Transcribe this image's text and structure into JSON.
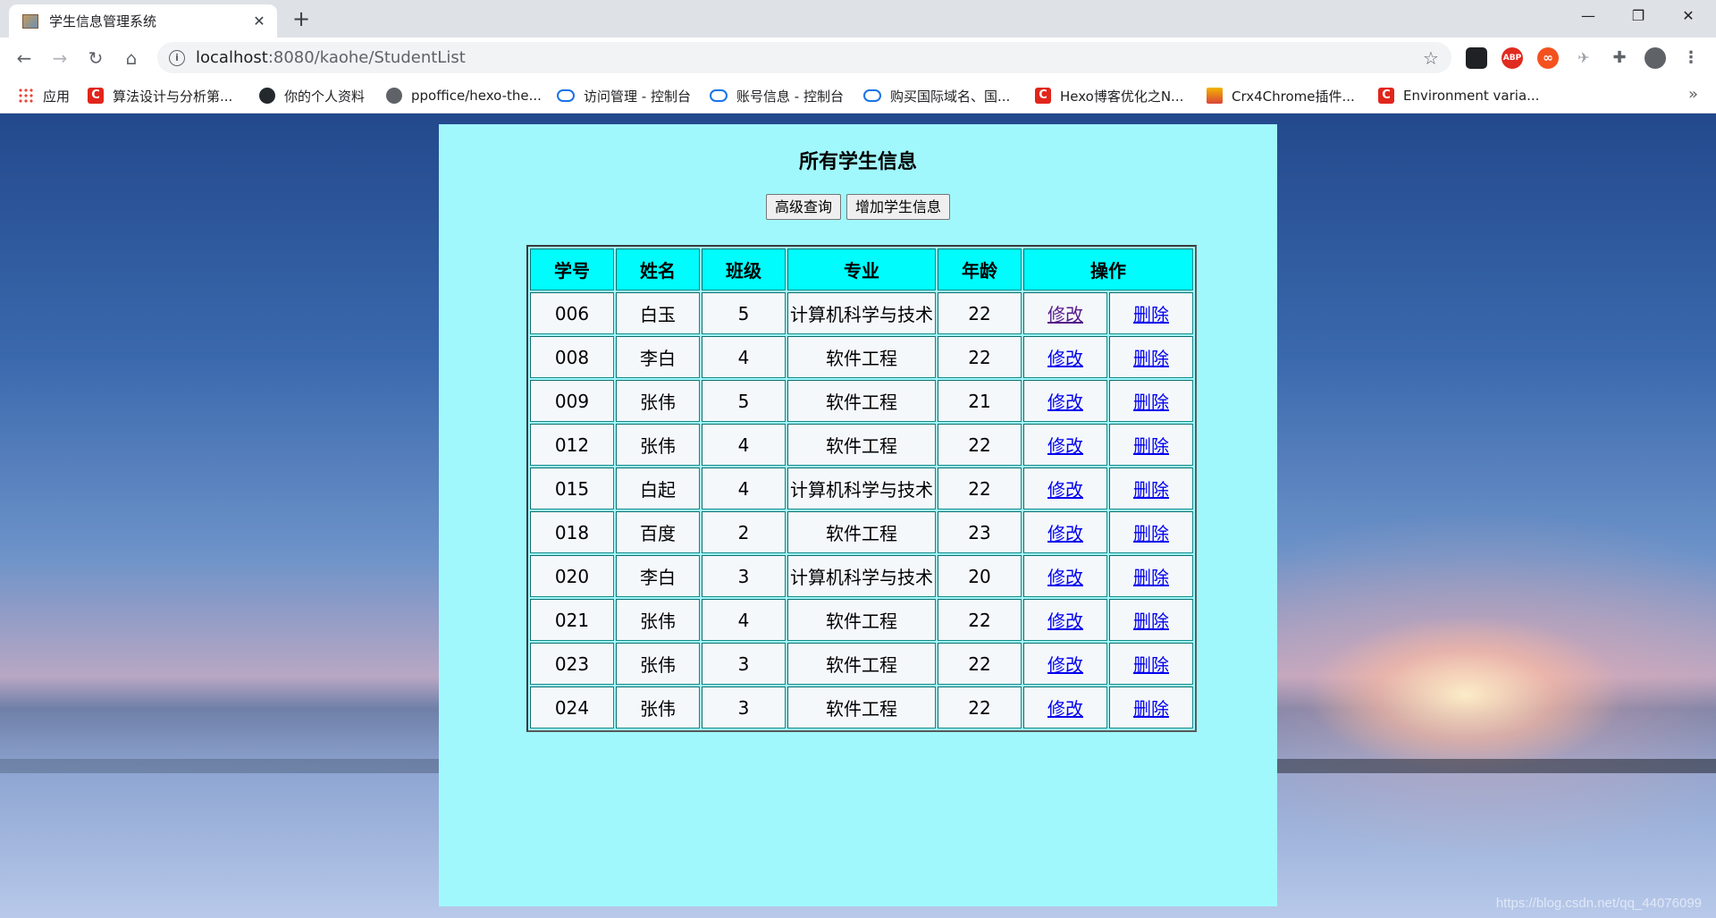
{
  "browser": {
    "tab_title": "学生信息管理系统",
    "tab_close": "✕",
    "new_tab": "+",
    "window_min": "—",
    "window_restore": "❐",
    "window_close": "✕",
    "url_host": "localhost",
    "url_path": ":8080/kaohe/StudentList",
    "bookmarks": [
      {
        "label": "应用",
        "icon": "apps-icon"
      },
      {
        "label": "算法设计与分析第...",
        "icon": "csdn-icon"
      },
      {
        "label": "你的个人资料",
        "icon": "github-icon"
      },
      {
        "label": "ppoffice/hexo-the...",
        "icon": "globe-icon"
      },
      {
        "label": "访问管理 - 控制台",
        "icon": "cloud-icon"
      },
      {
        "label": "账号信息 - 控制台",
        "icon": "cloud-icon"
      },
      {
        "label": "购买国际域名、国...",
        "icon": "cloud-icon"
      },
      {
        "label": "Hexo博客优化之N...",
        "icon": "csdn-icon"
      },
      {
        "label": "Crx4Chrome插件...",
        "icon": "hexo-icon"
      },
      {
        "label": "Environment varia...",
        "icon": "csdn-icon"
      }
    ],
    "bookmarks_more": "»",
    "extensions": [
      "ABP",
      "∞"
    ]
  },
  "page": {
    "title": "所有学生信息",
    "advanced_query_label": "高级查询",
    "add_student_label": "增加学生信息",
    "table": {
      "headers": {
        "id": "学号",
        "name": "姓名",
        "class": "班级",
        "major": "专业",
        "age": "年龄",
        "operation": "操作"
      },
      "edit_label": "修改",
      "delete_label": "删除",
      "rows": [
        {
          "id": "006",
          "name": "白玉",
          "class": "5",
          "major": "计算机科学与技术",
          "age": "22"
        },
        {
          "id": "008",
          "name": "李白",
          "class": "4",
          "major": "软件工程",
          "age": "22"
        },
        {
          "id": "009",
          "name": "张伟",
          "class": "5",
          "major": "软件工程",
          "age": "21"
        },
        {
          "id": "012",
          "name": "张伟",
          "class": "4",
          "major": "软件工程",
          "age": "22"
        },
        {
          "id": "015",
          "name": "白起",
          "class": "4",
          "major": "计算机科学与技术",
          "age": "22"
        },
        {
          "id": "018",
          "name": "百度",
          "class": "2",
          "major": "软件工程",
          "age": "23"
        },
        {
          "id": "020",
          "name": "李白",
          "class": "3",
          "major": "计算机科学与技术",
          "age": "20"
        },
        {
          "id": "021",
          "name": "张伟",
          "class": "4",
          "major": "软件工程",
          "age": "22"
        },
        {
          "id": "023",
          "name": "张伟",
          "class": "3",
          "major": "软件工程",
          "age": "22"
        },
        {
          "id": "024",
          "name": "张伟",
          "class": "3",
          "major": "软件工程",
          "age": "22"
        }
      ]
    }
  },
  "watermark": "https://blog.csdn.net/qq_44076099",
  "colors": {
    "panel_bg": "#a0f8fc",
    "header_bg": "#00fcfc",
    "link": "#0000ee",
    "visited_link": "#551a8b"
  }
}
